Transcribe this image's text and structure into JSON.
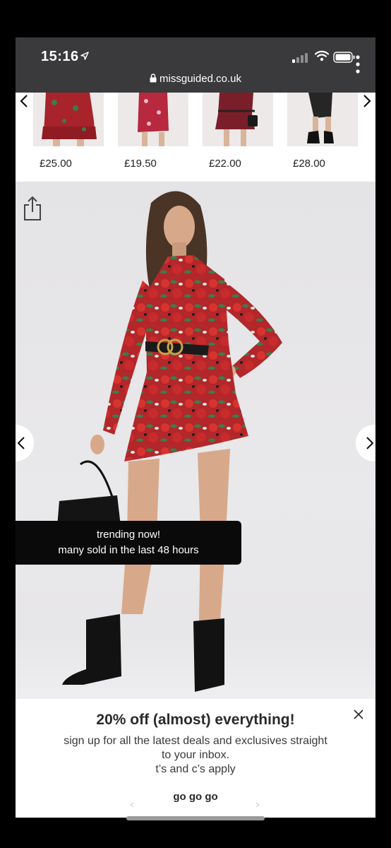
{
  "status": {
    "time": "15:16"
  },
  "browser": {
    "url": "missguided.co.uk"
  },
  "carousel": {
    "products": [
      {
        "price": "£25.00"
      },
      {
        "price": "£19.50"
      },
      {
        "price": "£22.00"
      },
      {
        "price": "£28.00"
      }
    ]
  },
  "hero": {
    "badge_line1": "trending now!",
    "badge_line2": "many sold in the last 48 hours"
  },
  "promo": {
    "title": "20% off (almost) everything!",
    "body_line1": "sign up for all the latest deals and exclusives straight",
    "body_line2": "to your inbox.",
    "body_line3": "t’s and c’s apply",
    "cta": "go go go"
  },
  "colors": {
    "dress_red": "#b3262a",
    "leaf_green": "#3f7a4a",
    "badge_bg": "#0a0a0a"
  }
}
